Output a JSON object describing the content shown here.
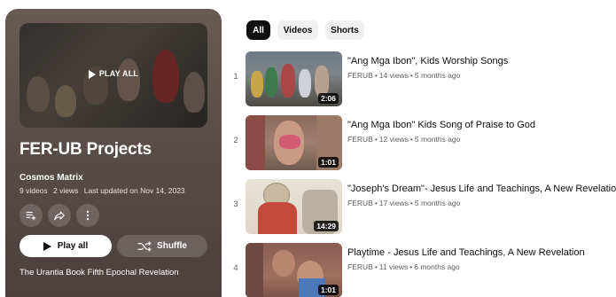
{
  "playlist": {
    "hero_label": "PLAY ALL",
    "title": "FER-UB Projects",
    "owner": "Cosmos Matrix",
    "videos_count": "9 videos",
    "views_count": "2 views",
    "last_updated": "Last updated on Nov 14, 2023",
    "play_all_label": "Play all",
    "shuffle_label": "Shuffle",
    "description": "The Urantia Book Fifth Epochal Revelation",
    "icons": [
      "add-to-queue-icon",
      "share-icon",
      "more-icon",
      "play-icon",
      "shuffle-icon"
    ]
  },
  "chips": [
    {
      "label": "All",
      "active": true
    },
    {
      "label": "Videos",
      "active": false
    },
    {
      "label": "Shorts",
      "active": false
    }
  ],
  "videos": [
    {
      "index": "1",
      "title": "\"Ang Mga Ibon\", Kids Worship Songs",
      "channel": "FERUB",
      "views": "14 views",
      "age": "5 months ago",
      "duration": "2:06"
    },
    {
      "index": "2",
      "title": "\"Ang Mga Ibon\" Kids Song of Praise to God",
      "channel": "FERUB",
      "views": "12 views",
      "age": "5 months ago",
      "duration": "1:01"
    },
    {
      "index": "3",
      "title": "\"Joseph's Dream\"- Jesus Life and Teachings, A New Revelation",
      "channel": "FERUB",
      "views": "17 views",
      "age": "5 months ago",
      "duration": "14:29"
    },
    {
      "index": "4",
      "title": "Playtime - Jesus Life and Teachings, A New Revelation",
      "channel": "FERUB",
      "views": "11 views",
      "age": "6 months ago",
      "duration": "1:01"
    }
  ],
  "separator": "•",
  "colors": {
    "panel": "#5a4d49",
    "chip_active": "#0f0f0f",
    "chip": "#f0f0f0",
    "meta_text": "#606060"
  }
}
